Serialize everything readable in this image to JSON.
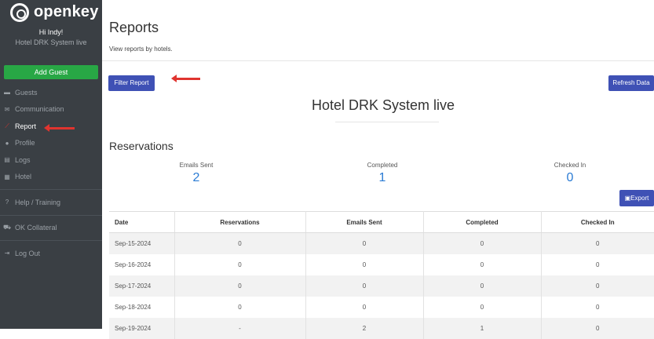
{
  "sidebar": {
    "logo_text": "openkey",
    "greeting": "Hi Indy!",
    "hotel_name": "Hotel DRK System live",
    "add_guest_label": "Add Guest",
    "items": [
      {
        "label": "Guests",
        "icon": "bed-icon"
      },
      {
        "label": "Communication",
        "icon": "envelope-icon"
      },
      {
        "label": "Report",
        "icon": "chart-icon"
      },
      {
        "label": "Profile",
        "icon": "user-icon"
      },
      {
        "label": "Logs",
        "icon": "list-icon"
      },
      {
        "label": "Hotel",
        "icon": "building-icon"
      },
      {
        "label": "Help / Training",
        "icon": "help-icon"
      },
      {
        "label": "OK Collateral",
        "icon": "cart-icon"
      },
      {
        "label": "Log Out",
        "icon": "logout-icon"
      }
    ]
  },
  "main": {
    "title": "Reports",
    "subtitle": "View reports by hotels.",
    "filter_button": "Filter Report",
    "refresh_button": "Refresh Data",
    "hotel_heading": "Hotel DRK System live",
    "reservations_title": "Reservations",
    "stats": [
      {
        "label": "Emails Sent",
        "value": "2"
      },
      {
        "label": "Completed",
        "value": "1"
      },
      {
        "label": "Checked In",
        "value": "0"
      }
    ],
    "export_button": "Export",
    "table": {
      "headers": [
        "Date",
        "Reservations",
        "Emails Sent",
        "Completed",
        "Checked In"
      ],
      "rows": [
        [
          "Sep-15-2024",
          "0",
          "0",
          "0",
          "0"
        ],
        [
          "Sep-16-2024",
          "0",
          "0",
          "0",
          "0"
        ],
        [
          "Sep-17-2024",
          "0",
          "0",
          "0",
          "0"
        ],
        [
          "Sep-18-2024",
          "0",
          "0",
          "0",
          "0"
        ],
        [
          "Sep-19-2024",
          "-",
          "2",
          "1",
          "0"
        ]
      ]
    }
  },
  "colors": {
    "sidebar_bg": "#3a3f44",
    "accent_green": "#28a745",
    "accent_blue": "#3f51b5",
    "stat_blue": "#2a7bd4",
    "active_icon": "#e0342f"
  }
}
